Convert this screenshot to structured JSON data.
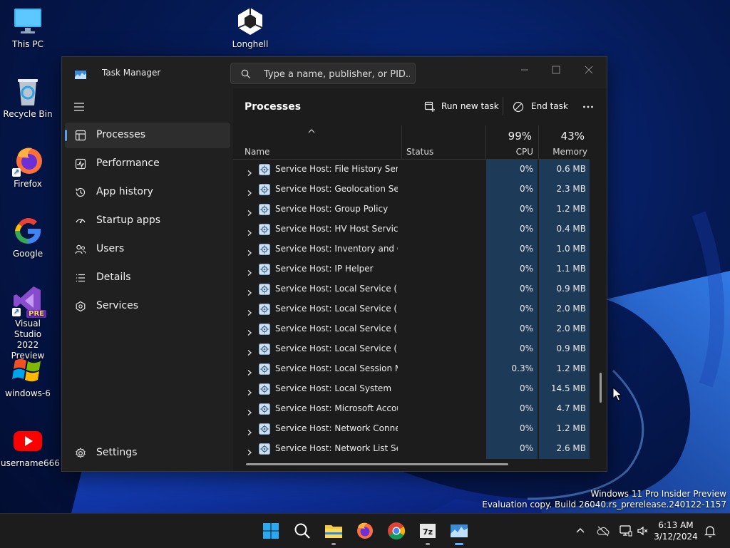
{
  "desktop": {
    "icons": [
      {
        "label": "This PC"
      },
      {
        "label": "Longhell"
      },
      {
        "label": "Recycle Bin"
      },
      {
        "label": "Firefox"
      },
      {
        "label": "Google"
      },
      {
        "label": "Visual Studio\n2022 Preview",
        "badge": "PRE"
      },
      {
        "label": "windows-6"
      },
      {
        "label": "username666"
      }
    ]
  },
  "window": {
    "title": "Task Manager",
    "search_placeholder": "Type a name, publisher, or PID..."
  },
  "sidebar": {
    "items": [
      {
        "label": "Processes",
        "icon": "processes-icon",
        "active": true
      },
      {
        "label": "Performance",
        "icon": "performance-icon"
      },
      {
        "label": "App history",
        "icon": "app-history-icon"
      },
      {
        "label": "Startup apps",
        "icon": "startup-apps-icon"
      },
      {
        "label": "Users",
        "icon": "users-icon"
      },
      {
        "label": "Details",
        "icon": "details-icon"
      },
      {
        "label": "Services",
        "icon": "services-icon"
      }
    ],
    "settings_label": "Settings"
  },
  "content": {
    "title": "Processes",
    "run_new_task": "Run new task",
    "end_task": "End task",
    "columns": {
      "name": "Name",
      "status": "Status",
      "cpu_pct": "99%",
      "cpu": "CPU",
      "mem_pct": "43%",
      "memory": "Memory"
    },
    "rows": [
      {
        "name": "Service Host: File History Servi...",
        "cpu": "0%",
        "mem": "0.6 MB"
      },
      {
        "name": "Service Host: Geolocation Serv...",
        "cpu": "0%",
        "mem": "2.3 MB"
      },
      {
        "name": "Service Host: Group Policy",
        "cpu": "0%",
        "mem": "1.2 MB"
      },
      {
        "name": "Service Host: HV Host Service",
        "cpu": "0%",
        "mem": "0.4 MB"
      },
      {
        "name": "Service Host: Inventory and C...",
        "cpu": "0%",
        "mem": "1.0 MB"
      },
      {
        "name": "Service Host: IP Helper",
        "cpu": "0%",
        "mem": "1.1 MB"
      },
      {
        "name": "Service Host: Local Service (N...",
        "cpu": "0%",
        "mem": "0.9 MB"
      },
      {
        "name": "Service Host: Local Service (N...",
        "cpu": "0%",
        "mem": "2.0 MB"
      },
      {
        "name": "Service Host: Local Service (N...",
        "cpu": "0%",
        "mem": "2.0 MB"
      },
      {
        "name": "Service Host: Local Service (N...",
        "cpu": "0%",
        "mem": "0.9 MB"
      },
      {
        "name": "Service Host: Local Session M...",
        "cpu": "0.3%",
        "mem": "1.2 MB"
      },
      {
        "name": "Service Host: Local System",
        "cpu": "0%",
        "mem": "14.5 MB"
      },
      {
        "name": "Service Host: Microsoft Accou...",
        "cpu": "0%",
        "mem": "4.7 MB"
      },
      {
        "name": "Service Host: Network Connec...",
        "cpu": "0%",
        "mem": "1.2 MB"
      },
      {
        "name": "Service Host: Network List Ser...",
        "cpu": "0%",
        "mem": "2.6 MB"
      }
    ]
  },
  "watermark": {
    "line1": "Windows 11 Pro Insider Preview",
    "line2": "Evaluation copy. Build 26040.rs_prerelease.240122-1157"
  },
  "taskbar": {
    "time": "6:13 AM",
    "date": "3/12/2024",
    "apps": [
      "start-icon",
      "search-icon",
      "file-explorer-icon",
      "firefox-icon",
      "chrome-icon",
      "7zip-icon",
      "task-manager-icon"
    ],
    "sevenzip_label": "7z"
  },
  "colors": {
    "window_bg": "#202020",
    "accent": "#5aa0e6",
    "heat": "#1d3a58",
    "taskbar": "#1c1c1c"
  }
}
